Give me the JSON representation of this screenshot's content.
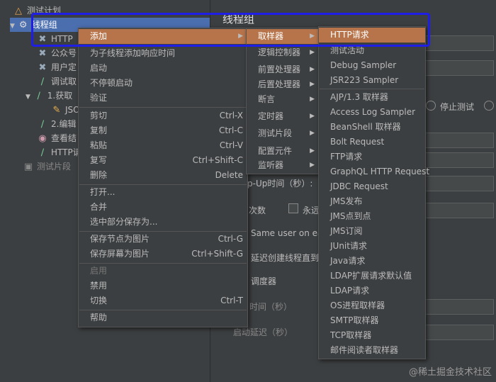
{
  "tree": {
    "items": [
      {
        "label": "测试计划",
        "icon": "flask-icon"
      },
      {
        "label": "线程组",
        "icon": "gear-icon"
      },
      {
        "label": "HTTP",
        "icon": "wrench-icon"
      },
      {
        "label": "公众号",
        "icon": "wrench-icon"
      },
      {
        "label": "用户定",
        "icon": "wrench-icon"
      },
      {
        "label": "调试取",
        "icon": "pipette-icon"
      },
      {
        "label": "1.获取",
        "icon": "pipette-icon"
      },
      {
        "label": "JSO",
        "icon": "script-icon"
      },
      {
        "label": "2.编辑",
        "icon": "pipette-icon"
      },
      {
        "label": "查看结",
        "icon": "eye-icon"
      },
      {
        "label": "HTTP请",
        "icon": "pipette-icon"
      },
      {
        "label": "测试片段",
        "icon": "fragment-icon"
      }
    ]
  },
  "right": {
    "title": "线程组",
    "radio_stop_test": "停止测试",
    "rampup_label": "p-Up时间（秒）:",
    "loop_label": "次数",
    "forever_label": "永远",
    "same_user": "Same user on each",
    "delay_create": "延迟创建线程直到",
    "scheduler": "调度器",
    "duration": "时间（秒）",
    "startup_delay": "启动延迟（秒）"
  },
  "context_menu": {
    "items": [
      {
        "label": "添加",
        "submenu": true,
        "highlight": true
      },
      {
        "label": "为子线程添加响应时间"
      },
      {
        "label": "启动"
      },
      {
        "label": "不停顿启动"
      },
      {
        "label": "验证"
      },
      {
        "sep": true
      },
      {
        "label": "剪切",
        "shortcut": "Ctrl-X"
      },
      {
        "label": "复制",
        "shortcut": "Ctrl-C"
      },
      {
        "label": "粘贴",
        "shortcut": "Ctrl-V"
      },
      {
        "label": "复写",
        "shortcut": "Ctrl+Shift-C"
      },
      {
        "label": "删除",
        "shortcut": "Delete"
      },
      {
        "sep": true
      },
      {
        "label": "打开..."
      },
      {
        "label": "合并"
      },
      {
        "label": "选中部分保存为..."
      },
      {
        "sep": true
      },
      {
        "label": "保存节点为图片",
        "shortcut": "Ctrl-G"
      },
      {
        "label": "保存屏幕为图片",
        "shortcut": "Ctrl+Shift-G"
      },
      {
        "sep": true
      },
      {
        "label": "启用",
        "disabled": true
      },
      {
        "label": "禁用"
      },
      {
        "label": "切换",
        "shortcut": "Ctrl-T"
      },
      {
        "sep": true
      },
      {
        "label": "帮助"
      }
    ]
  },
  "add_menu": {
    "items": [
      {
        "label": "取样器",
        "highlight": true
      },
      {
        "label": "逻辑控制器"
      },
      {
        "label": "前置处理器"
      },
      {
        "label": "后置处理器"
      },
      {
        "label": "断言"
      },
      {
        "label": "定时器"
      },
      {
        "label": "测试片段"
      },
      {
        "label": "配置元件"
      },
      {
        "label": "监听器"
      }
    ]
  },
  "sampler_menu": {
    "items": [
      {
        "label": "HTTP请求",
        "highlight": true
      },
      {
        "label": "测试活动"
      },
      {
        "label": "Debug Sampler"
      },
      {
        "label": "JSR223 Sampler"
      },
      {
        "sep": true
      },
      {
        "label": "AJP/1.3 取样器"
      },
      {
        "label": "Access Log Sampler"
      },
      {
        "label": "BeanShell 取样器"
      },
      {
        "label": "Bolt Request"
      },
      {
        "label": "FTP请求"
      },
      {
        "label": "GraphQL HTTP Request"
      },
      {
        "label": "JDBC Request"
      },
      {
        "label": "JMS发布"
      },
      {
        "label": "JMS点到点"
      },
      {
        "label": "JMS订阅"
      },
      {
        "label": "JUnit请求"
      },
      {
        "label": "Java请求"
      },
      {
        "label": "LDAP扩展请求默认值"
      },
      {
        "label": "LDAP请求"
      },
      {
        "label": "OS进程取样器"
      },
      {
        "label": "SMTP取样器"
      },
      {
        "label": "TCP取样器"
      },
      {
        "label": "邮件阅读者取样器"
      }
    ]
  },
  "watermark": "@稀土掘金技术社区",
  "colors": {
    "highlight": "#b7744a",
    "annotation": "#1e1ee6"
  }
}
